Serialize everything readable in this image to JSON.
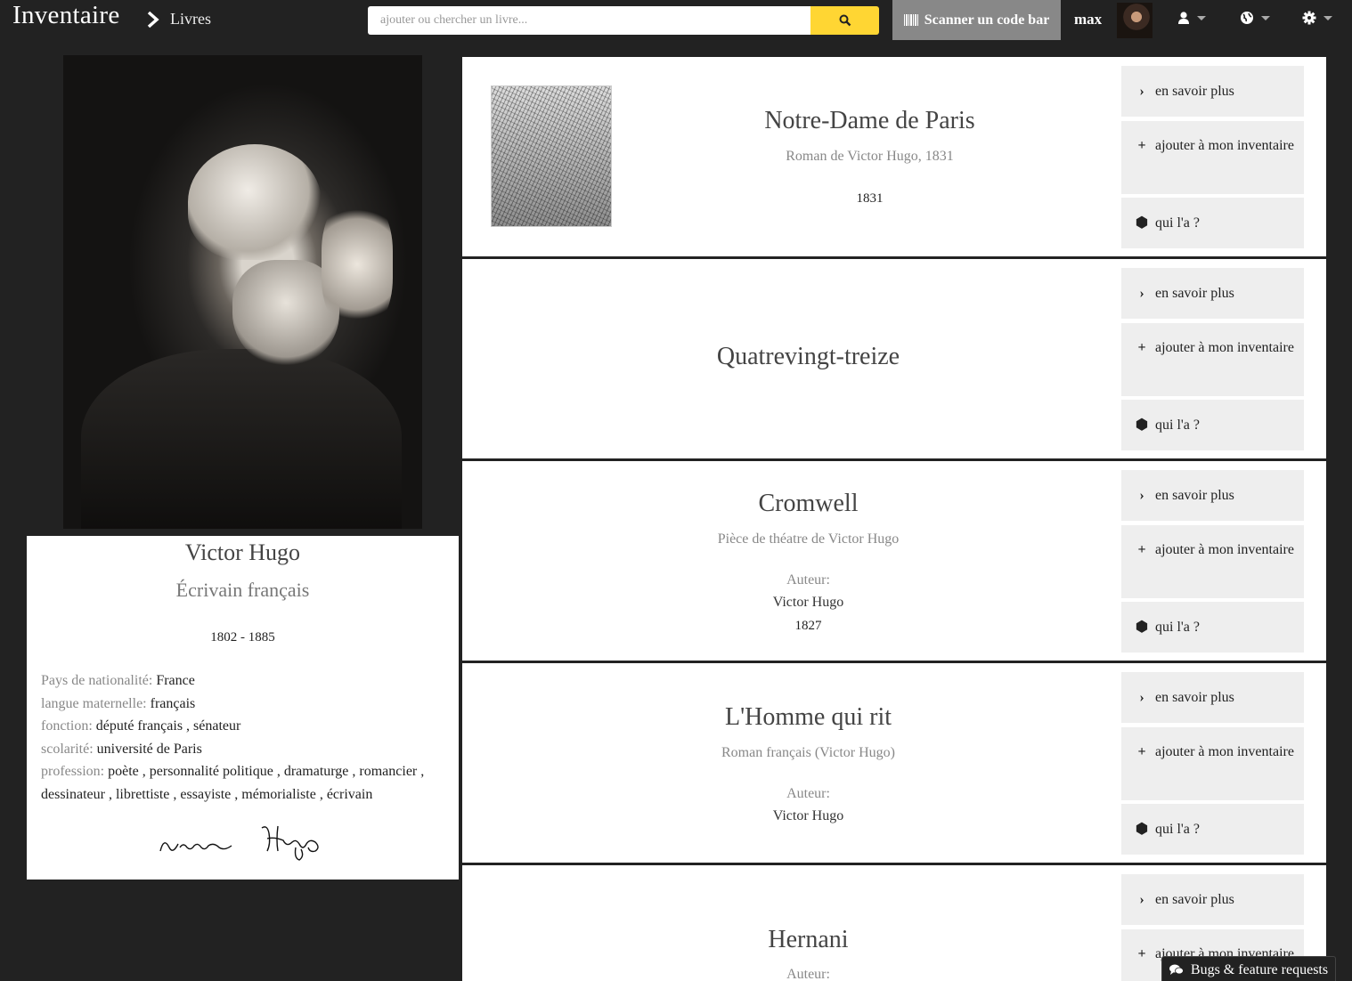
{
  "header": {
    "brand": "Inventaire",
    "breadcrumb": "Livres",
    "search_placeholder": "ajouter ou chercher un livre...",
    "scan_label": "Scanner un code bar",
    "username": "max",
    "accent_color": "#FFD633"
  },
  "author": {
    "name": "Victor Hugo",
    "description": "Écrivain français",
    "dates": "1802  -  1885",
    "claims": [
      {
        "label": "Pays de nationalité:",
        "value": "France"
      },
      {
        "label": "langue maternelle:",
        "value": "français"
      },
      {
        "label": "fonction:",
        "value": "député français , sénateur"
      },
      {
        "label": "scolarité:",
        "value": "université de Paris"
      },
      {
        "label": "profession:",
        "value": "poète , personnalité politique , dramaturge , romancier , dessinateur , librettiste , essayiste , mémorialiste , écrivain"
      }
    ],
    "signature_text": "Victor Hugo"
  },
  "actions": {
    "more": "en savoir plus",
    "add": "ajouter à mon inventaire",
    "who": "qui l'a ?"
  },
  "works": [
    {
      "title": "Notre-Dame de Paris",
      "subtitle": "Roman de Victor Hugo, 1831",
      "author_label": "",
      "author": "",
      "year": "1831",
      "has_cover": true
    },
    {
      "title": "Quatrevingt-treize",
      "subtitle": "",
      "author_label": "",
      "author": "",
      "year": "",
      "has_cover": false
    },
    {
      "title": "Cromwell",
      "subtitle": "Pièce de théatre de Victor Hugo",
      "author_label": "Auteur:",
      "author": "Victor Hugo",
      "year": "1827",
      "has_cover": false
    },
    {
      "title": "L'Homme qui rit",
      "subtitle": "Roman français (Victor Hugo)",
      "author_label": "Auteur:",
      "author": "Victor Hugo",
      "year": "",
      "has_cover": false
    },
    {
      "title": "Hernani",
      "subtitle": "",
      "author_label": "Auteur:",
      "author": "",
      "year": "",
      "has_cover": false
    }
  ],
  "feedback": {
    "label": "Bugs & feature requests"
  }
}
